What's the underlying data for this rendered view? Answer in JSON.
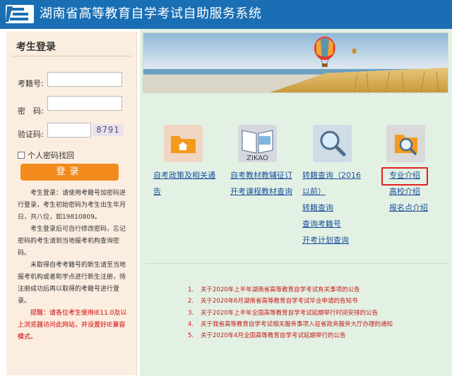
{
  "header": {
    "title": "湖南省高等教育自学考试自助服务系统",
    "bg_color": "#1a6fb4",
    "logo_icon": "edu-logo-icon"
  },
  "login": {
    "title": "考生登录",
    "fields": {
      "exam_no_label": "考籍号:",
      "password_label": "密　码:",
      "captcha_label": "验证码:",
      "exam_no_value": "",
      "password_value": "",
      "captcha_value": ""
    },
    "captcha_text": "8791",
    "retrieve_label": "个人密码找回",
    "login_button": "登录",
    "button_color": "#f28b1c",
    "notes": [
      "考生登录：请使用考籍号加密码进行登录，考生初始密码为考生出生年月日，共八位，如19810809。",
      "考生登录后可自行修改密码，忘记密码的考生请到当地报考机构查询密码。",
      "未取得自考考籍号的新生请至当地报考机构或者助学点进行新生注册，待注册成功后再以取得的考籍号进行登录。"
    ],
    "tip": "提醒：请各位考生使用IE11.0及以上浏览器访问此网站，并设置好IE兼容模式。"
  },
  "services": [
    {
      "icon": "folder-home-icon",
      "links": [
        "自考政策及相关通告"
      ]
    },
    {
      "icon": "book-zikao-icon",
      "icon_text": "ZIKAO",
      "links": [
        "自考教材教辅征订",
        "开考课程教材查询"
      ]
    },
    {
      "icon": "magnifier-icon",
      "links": [
        "转籍查询（2016以前）",
        "转籍查询",
        "查询考籍号",
        "开考计划查询"
      ]
    },
    {
      "icon": "search-folder-icon",
      "links": [
        "专业介绍",
        "高校介绍",
        "报名点介绍"
      ]
    }
  ],
  "notices": [
    {
      "num": "1.",
      "text": "关于2020年上半年湖南省高等教育自学考试有关事项的公告"
    },
    {
      "num": "2.",
      "text": "关于2020年6月湖南省高等教育自学考试毕业申请的告知书"
    },
    {
      "num": "3.",
      "text": "关于2020年上半年全国高等教育自学考试延期举行时间安排的公告"
    },
    {
      "num": "4.",
      "text": "关于我省高等教育自学考试相关服务事项入驻省政务服务大厅办理的通知"
    },
    {
      "num": "5.",
      "text": "关于2020年4月全国高等教育自学考试延期举行的公告"
    }
  ],
  "colors": {
    "link": "#1a4f9e",
    "notice": "#c51a1a",
    "main_bg": "#e3f1e4",
    "sidebar_bg": "#fbeee0"
  }
}
